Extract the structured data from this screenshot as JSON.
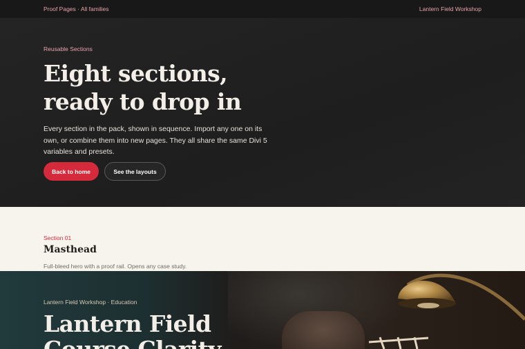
{
  "topbar": {
    "breadcrumb": "Proof Pages · All families",
    "site_name": "Lantern Field Workshop"
  },
  "hero": {
    "eyebrow": "Reusable Sections",
    "title_line1": "Eight sections,",
    "title_line2": "ready to drop in",
    "description": "Every section in the pack, shown in sequence. Import any one on its own, or combine them into new pages. They all share the same Divi 5 variables and presets.",
    "primary_button": "Back to home",
    "secondary_button": "See the layouts"
  },
  "section": {
    "label": "Section 01",
    "title": "Masthead",
    "description": "Full-bleed hero with a proof rail. Opens any case study."
  },
  "preview": {
    "eyebrow": "Lantern Field Workshop · Education",
    "title_line1": "Lantern Field",
    "title_line2": "Course Clarity"
  },
  "colors": {
    "accent": "#d52a3b",
    "eyebrow_pink": "#e8a3ac",
    "hero_bg": "#1f1f1f",
    "section_bg": "#f7f4ee"
  }
}
